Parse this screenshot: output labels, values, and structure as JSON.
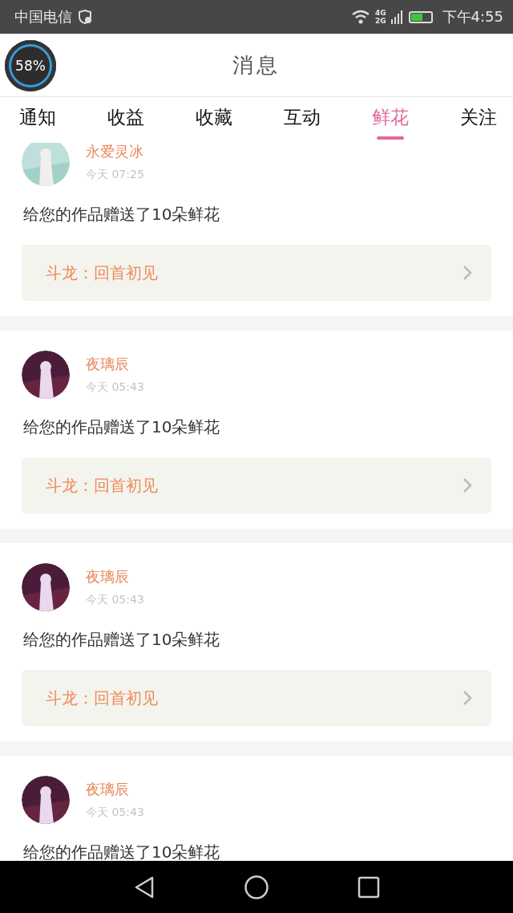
{
  "status_bar": {
    "carrier": "中国电信",
    "network_top": "4G",
    "network_bottom": "2G",
    "time": "下午4:55"
  },
  "overlay_badge": {
    "text": "58%"
  },
  "header": {
    "title": "消息"
  },
  "tabs": [
    {
      "label": "通知",
      "selected": false
    },
    {
      "label": "收益",
      "selected": false
    },
    {
      "label": "收藏",
      "selected": false
    },
    {
      "label": "互动",
      "selected": false
    },
    {
      "label": "鲜花",
      "selected": true
    },
    {
      "label": "关注",
      "selected": false
    }
  ],
  "messages": [
    {
      "name": "永爱灵冰",
      "time": "今天 07:25",
      "text": "给您的作品赠送了10朵鲜花",
      "book": "斗龙：回首初见"
    },
    {
      "name": "夜璃辰",
      "time": "今天 05:43",
      "text": "给您的作品赠送了10朵鲜花",
      "book": "斗龙：回首初见"
    },
    {
      "name": "夜璃辰",
      "time": "今天 05:43",
      "text": "给您的作品赠送了10朵鲜花",
      "book": "斗龙：回首初见"
    },
    {
      "name": "夜璃辰",
      "time": "今天 05:43",
      "text": "给您的作品赠送了10朵鲜花"
    }
  ]
}
